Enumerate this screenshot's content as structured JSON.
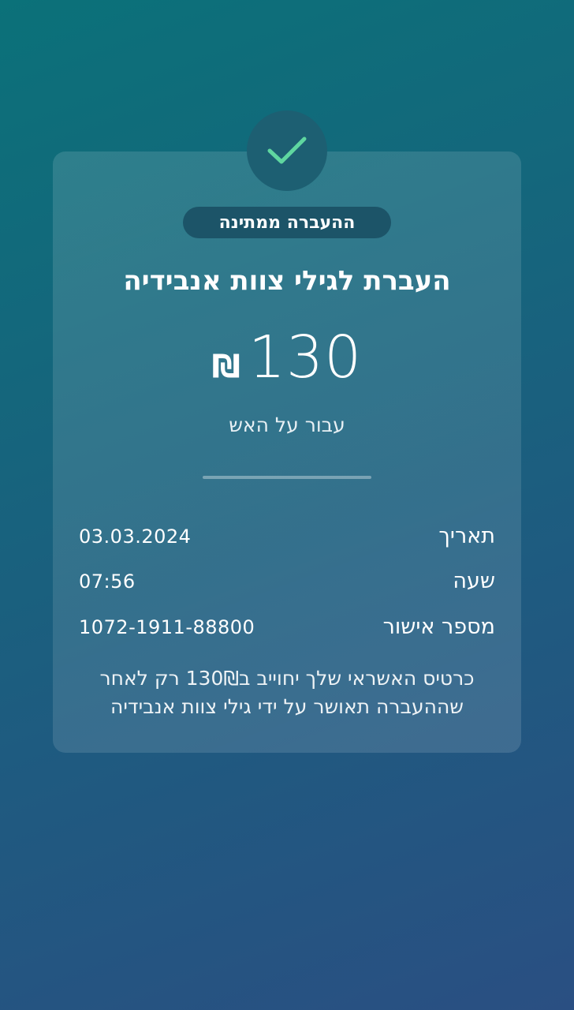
{
  "status": {
    "label": "ההעברה ממתינה"
  },
  "transfer": {
    "title": "העברת לגילי צוות אנבידיה",
    "currency": "₪",
    "amount": "130",
    "subtitle": "עבור על האש"
  },
  "details": [
    {
      "label": "תאריך",
      "value": "03.03.2024"
    },
    {
      "label": "שעה",
      "value": "07:56"
    },
    {
      "label": "מספר אישור",
      "value": "1072-1911-88800"
    }
  ],
  "note": "כרטיס האשראי שלך יחוייב ב130₪ רק לאחר שההעברה תאושר על ידי גילי צוות אנבידיה",
  "colors": {
    "check": "#5fd6a0",
    "background_top": "#0b7179",
    "background_bottom": "#2a4f82"
  },
  "icons": {
    "status_icon": "check-icon"
  }
}
